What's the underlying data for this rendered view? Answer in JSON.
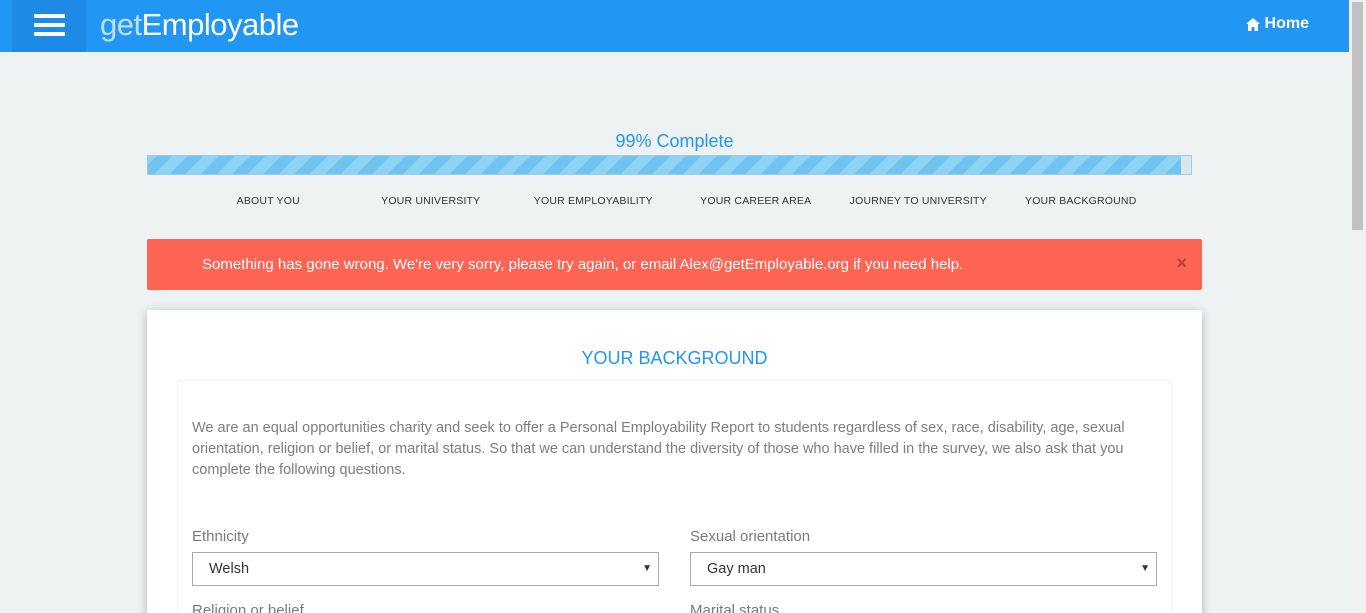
{
  "header": {
    "logo_prefix": "get",
    "logo_main": "Employable",
    "home_label": "Home"
  },
  "progress": {
    "label": "99% Complete",
    "percent": 99
  },
  "steps": [
    "ABOUT YOU",
    "YOUR UNIVERSITY",
    "YOUR EMPLOYABILITY",
    "YOUR CAREER AREA",
    "JOURNEY TO UNIVERSITY",
    "YOUR BACKGROUND"
  ],
  "alert": {
    "message": "Something has gone wrong. We're very sorry, please try again, or email Alex@getEmployable.org if you need help.",
    "close": "×"
  },
  "section": {
    "title": "YOUR BACKGROUND",
    "intro": "We are an equal opportunities charity and seek to offer a Personal Employability Report to students regardless of sex, race, disability, age, sexual orientation, religion or belief, or marital status. So that we can understand the diversity of those who have filled in the survey, we also ask that you complete the following questions."
  },
  "fields": {
    "ethnicity": {
      "label": "Ethnicity",
      "value": "Welsh"
    },
    "sexual_orientation": {
      "label": "Sexual orientation",
      "value": "Gay man"
    },
    "religion": {
      "label": "Religion or belief"
    },
    "marital": {
      "label": "Marital status"
    }
  },
  "colors": {
    "brand": "#2196f3",
    "alert": "#fe6454",
    "background": "#eff2f3"
  }
}
